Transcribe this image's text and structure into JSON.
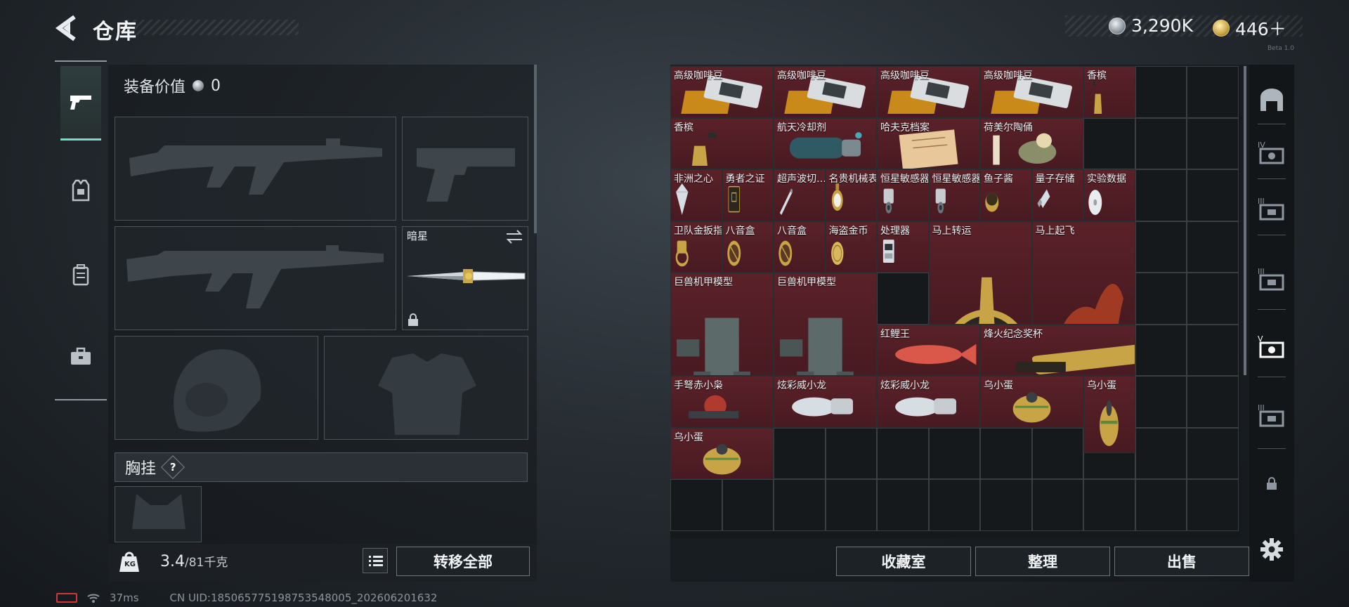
{
  "header": {
    "title": "仓库",
    "silver": "3,290K",
    "gold": "446＋",
    "version": "Beta 1.0"
  },
  "loadout": {
    "equip_value_label": "装备价值",
    "equip_value": "0",
    "melee_name": "暗星",
    "vest_label": "胸挂",
    "vest_help": "?"
  },
  "footer": {
    "weight_current": "3.4",
    "weight_max": "/81千克",
    "weight_icon_text": "KG",
    "transfer_all": "转移全部",
    "collection_room": "收藏室",
    "organize": "整理",
    "sell": "出售"
  },
  "storage_items": [
    {
      "name": "高级咖啡豆",
      "icon": "coffee-bean-box-icon",
      "c": 0,
      "r": 0,
      "w": 1,
      "h": 1
    },
    {
      "name": "高级咖啡豆",
      "icon": "coffee-bean-box-icon",
      "c": 1,
      "r": 0,
      "w": 1,
      "h": 1
    },
    {
      "name": "高级咖啡豆",
      "icon": "coffee-bean-box-icon",
      "c": 2,
      "r": 0,
      "w": 1,
      "h": 1
    },
    {
      "name": "高级咖啡豆",
      "icon": "coffee-bean-box-icon",
      "c": 3,
      "r": 0,
      "w": 1,
      "h": 1
    },
    {
      "name": "香槟",
      "icon": "champagne-bottle-icon",
      "c": 4,
      "r": 0,
      "w": 0.5,
      "h": 1
    },
    {
      "name": "香槟",
      "icon": "champagne-bottle-icon",
      "c": 0,
      "r": 1,
      "w": 1,
      "h": 1
    },
    {
      "name": "航天冷却剂",
      "icon": "coolant-tank-icon",
      "c": 1,
      "r": 1,
      "w": 1,
      "h": 1
    },
    {
      "name": "哈夫克档案",
      "icon": "document-file-icon",
      "c": 2,
      "r": 1,
      "w": 1,
      "h": 1
    },
    {
      "name": "荷美尔陶俑",
      "icon": "ceramic-figurine-icon",
      "c": 3,
      "r": 1,
      "w": 1,
      "h": 1
    },
    {
      "name": "非洲之心",
      "icon": "diamond-icon",
      "c": 0,
      "r": 2,
      "w": 0.5,
      "h": 1
    },
    {
      "name": "勇者之证",
      "icon": "card-icon",
      "c": 0.5,
      "r": 2,
      "w": 0.5,
      "h": 1
    },
    {
      "name": "超声波切…",
      "icon": "scalpel-icon",
      "c": 1,
      "r": 2,
      "w": 0.5,
      "h": 1
    },
    {
      "name": "名贵机械表",
      "icon": "gold-watch-icon",
      "c": 1.5,
      "r": 2,
      "w": 0.5,
      "h": 1
    },
    {
      "name": "恒星敏感器",
      "icon": "sensor-icon",
      "c": 2,
      "r": 2,
      "w": 0.5,
      "h": 1
    },
    {
      "name": "恒星敏感器",
      "icon": "sensor-icon",
      "c": 2.5,
      "r": 2,
      "w": 0.5,
      "h": 1
    },
    {
      "name": "鱼子酱",
      "icon": "caviar-tin-icon",
      "c": 3,
      "r": 2,
      "w": 0.5,
      "h": 1
    },
    {
      "name": "量子存储",
      "icon": "usb-drive-icon",
      "c": 3.5,
      "r": 2,
      "w": 0.5,
      "h": 1
    },
    {
      "name": "实验数据",
      "icon": "disc-icon",
      "c": 4,
      "r": 2,
      "w": 0.5,
      "h": 1
    },
    {
      "name": "卫队金扳指",
      "icon": "gold-ring-icon",
      "c": 0,
      "r": 3,
      "w": 0.5,
      "h": 1
    },
    {
      "name": "八音盒",
      "icon": "music-box-icon",
      "c": 0.5,
      "r": 3,
      "w": 0.5,
      "h": 1
    },
    {
      "name": "八音盒",
      "icon": "music-box-icon",
      "c": 1,
      "r": 3,
      "w": 0.5,
      "h": 1
    },
    {
      "name": "海盗金币",
      "icon": "gold-coin-icon",
      "c": 1.5,
      "r": 3,
      "w": 0.5,
      "h": 1
    },
    {
      "name": "处理器",
      "icon": "processor-icon",
      "c": 2,
      "r": 3,
      "w": 0.5,
      "h": 1
    },
    {
      "name": "马上转运",
      "icon": "horse-wheel-icon",
      "c": 2.5,
      "r": 3,
      "w": 1,
      "h": 2
    },
    {
      "name": "马上起飞",
      "icon": "red-horse-icon",
      "c": 3.5,
      "r": 3,
      "w": 1,
      "h": 2
    },
    {
      "name": "巨兽机甲模型",
      "icon": "mech-model-icon",
      "c": 0,
      "r": 4,
      "w": 1,
      "h": 2
    },
    {
      "name": "巨兽机甲模型",
      "icon": "mech-model-icon",
      "c": 1,
      "r": 4,
      "w": 1,
      "h": 2
    },
    {
      "name": "红鲤王",
      "icon": "red-carp-icon",
      "c": 2,
      "r": 5,
      "w": 1,
      "h": 1
    },
    {
      "name": "烽火纪念奖杯",
      "icon": "trophy-icon",
      "c": 3,
      "r": 5,
      "w": 1.5,
      "h": 1
    },
    {
      "name": "手弩赤小枭",
      "icon": "owl-crossbow-icon",
      "c": 0,
      "r": 6,
      "w": 1,
      "h": 1
    },
    {
      "name": "炫彩威小龙",
      "icon": "dragon-gauntlet-icon",
      "c": 1,
      "r": 6,
      "w": 1,
      "h": 1
    },
    {
      "name": "炫彩威小龙",
      "icon": "dragon-gauntlet-icon",
      "c": 2,
      "r": 6,
      "w": 1,
      "h": 1
    },
    {
      "name": "乌小蛋",
      "icon": "egg-figure-icon",
      "c": 3,
      "r": 6,
      "w": 1,
      "h": 1
    },
    {
      "name": "乌小蛋",
      "icon": "egg-figure-icon",
      "c": 4,
      "r": 6,
      "w": 0.5,
      "h": 1.5
    },
    {
      "name": "乌小蛋",
      "icon": "egg-figure-icon",
      "c": 0,
      "r": 7,
      "w": 1,
      "h": 1
    }
  ],
  "status": {
    "ping": "37ms",
    "uid": "CN UID:18506577519875354800​5_202606201632"
  },
  "colors": {
    "accent": "#6fe0c6",
    "item_bg": "#5b2129",
    "battery": "#d7333a"
  }
}
